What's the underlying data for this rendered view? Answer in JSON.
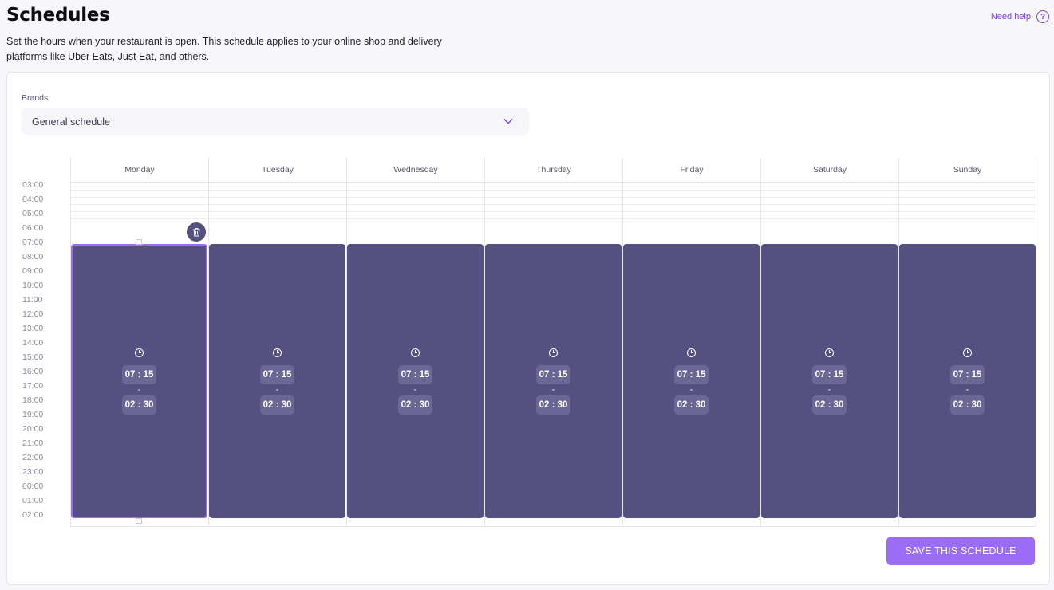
{
  "header": {
    "title": "Schedules",
    "subtitle": "Set the hours when your restaurant is open. This schedule applies to your online shop and delivery platforms like Uber Eats, Just Eat, and others.",
    "help_label": "Need help",
    "help_icon": "question-circle-icon"
  },
  "brands": {
    "label": "Brands",
    "selected": "General schedule"
  },
  "hours": [
    "03:00",
    "04:00",
    "05:00",
    "06:00",
    "07:00",
    "08:00",
    "09:00",
    "10:00",
    "11:00",
    "12:00",
    "13:00",
    "14:00",
    "15:00",
    "16:00",
    "17:00",
    "18:00",
    "19:00",
    "20:00",
    "21:00",
    "22:00",
    "23:00",
    "00:00",
    "01:00",
    "02:00"
  ],
  "days": [
    {
      "name": "Monday",
      "start": "07 : 15",
      "dash": "-",
      "end": "02 : 30",
      "selected": true
    },
    {
      "name": "Tuesday",
      "start": "07 : 15",
      "dash": "-",
      "end": "02 : 30",
      "selected": false
    },
    {
      "name": "Wednesday",
      "start": "07 : 15",
      "dash": "-",
      "end": "02 : 30",
      "selected": false
    },
    {
      "name": "Thursday",
      "start": "07 : 15",
      "dash": "-",
      "end": "02 : 30",
      "selected": false
    },
    {
      "name": "Friday",
      "start": "07 : 15",
      "dash": "-",
      "end": "02 : 30",
      "selected": false
    },
    {
      "name": "Saturday",
      "start": "07 : 15",
      "dash": "-",
      "end": "02 : 30",
      "selected": false
    },
    {
      "name": "Sunday",
      "start": "07 : 15",
      "dash": "-",
      "end": "02 : 30",
      "selected": false
    }
  ],
  "actions": {
    "save_label": "SAVE THIS SCHEDULE"
  },
  "colors": {
    "accent": "#9b6cf5",
    "block": "#545181",
    "help": "#7b3fe4"
  }
}
